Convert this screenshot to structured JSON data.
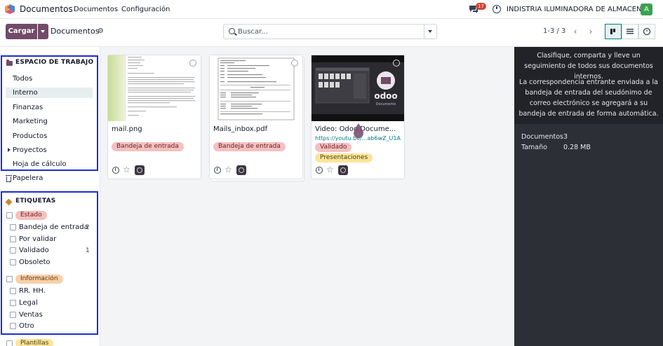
{
  "navbar": {
    "app_name": "Documentos",
    "menu": [
      "Documentos",
      "Configuración"
    ],
    "chat_count": "17",
    "company": "INDISTRIA ILUMINADORA DE ALMACENES",
    "avatar_letter": "A"
  },
  "control_panel": {
    "upload_label": "Cargar",
    "title": "Documentos",
    "search_placeholder": "Buscar...",
    "pager": "1-3 / 3"
  },
  "sidebar": {
    "workspace_title": "ESPACIO DE TRABAJO",
    "workspaces": [
      "Todos",
      "Interno",
      "Finanzas",
      "Marketing",
      "Productos",
      "Proyectos",
      "Hoja de cálculo"
    ],
    "active_workspace": "Interno",
    "trash_label": "Papelera",
    "tags_title": "ETIQUETAS",
    "tag_groups": [
      {
        "name": "Estado",
        "tags": [
          {
            "label": "Bandeja de entrada",
            "count": "2"
          },
          {
            "label": "Por validar",
            "count": ""
          },
          {
            "label": "Validado",
            "count": "1"
          },
          {
            "label": "Obsoleto",
            "count": ""
          }
        ]
      },
      {
        "name": "Información",
        "tags": [
          {
            "label": "RR. HH.",
            "count": ""
          },
          {
            "label": "Legal",
            "count": ""
          },
          {
            "label": "Ventas",
            "count": ""
          },
          {
            "label": "Otro",
            "count": ""
          }
        ]
      },
      {
        "name": "Plantillas",
        "tags": []
      }
    ]
  },
  "documents": [
    {
      "name": "mail.png",
      "tags": [
        "Bandeja de entrada"
      ],
      "url": ""
    },
    {
      "name": "Mails_inbox.pdf",
      "tags": [
        "Bandeja de entrada"
      ],
      "url": ""
    },
    {
      "name": "Video: Odoo Docume...",
      "tags": [
        "Validado",
        "Presentaciones"
      ],
      "url": "https://youtu.be/...ab6wZ_U1A"
    }
  ],
  "info_panel": {
    "intro": "Clasifique, comparta y lleve un seguimiento de todos sus documentos internos.",
    "inbox_note": "La correspondencia entrante enviada a la bandeja de entrada del seudónimo de correo electrónico se agregará a su bandeja de entrada de forma automática.",
    "stats": [
      {
        "label": "Documentos",
        "value": "3"
      },
      {
        "label": "Tamaño",
        "value": "0.28 MB"
      }
    ]
  },
  "colors": {
    "brand": "#714b67",
    "accent": "#017e84",
    "highlight_box": "#1c2fd1",
    "tag_red": "#f5c0c0",
    "tag_orange": "#f9d0a8",
    "tag_yellow": "#fbe59a"
  }
}
